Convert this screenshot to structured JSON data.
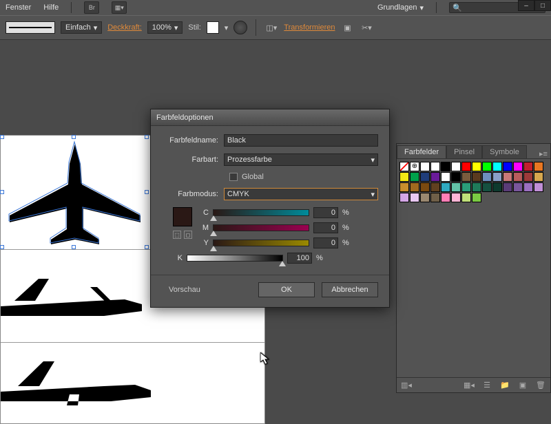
{
  "menubar": {
    "window": "Fenster",
    "help": "Hilfe",
    "br": "Br",
    "workspace": "Grundlagen"
  },
  "optbar": {
    "stroke_style": "Einfach",
    "opacity_label": "Deckkraft:",
    "opacity_value": "100%",
    "style_label": "Stil:",
    "transform": "Transformieren"
  },
  "dialog": {
    "title": "Farbfeldoptionen",
    "name_label": "Farbfeldname:",
    "name_value": "Black",
    "type_label": "Farbart:",
    "type_value": "Prozessfarbe",
    "global_label": "Global",
    "mode_label": "Farbmodus:",
    "mode_value": "CMYK",
    "channels": {
      "c": {
        "label": "C",
        "value": "0"
      },
      "m": {
        "label": "M",
        "value": "0"
      },
      "y": {
        "label": "Y",
        "value": "0"
      },
      "k": {
        "label": "K",
        "value": "100"
      }
    },
    "percent": "%",
    "preview_label": "Vorschau",
    "ok": "OK",
    "cancel": "Abbrechen"
  },
  "panel": {
    "tabs": {
      "swatches": "Farbfelder",
      "brushes": "Pinsel",
      "symbols": "Symbole"
    },
    "swatches": [
      "#ffffff",
      "#ffffff",
      "#000000",
      "#ffffff",
      "#ff0000",
      "#ffff00",
      "#00ff00",
      "#00ffff",
      "#0000ff",
      "#ff00ff",
      "#c01f2e",
      "#e87722",
      "#f6eb16",
      "#00a14b",
      "#1f3d7a",
      "#6a1b9a",
      "#ffffff",
      "#000000",
      "#7a5c3e",
      "#5a3a1f",
      "#6d8fbf",
      "#8aa0c8",
      "#c87878",
      "#b85c5c",
      "#9c3a3a",
      "#d6a84f",
      "#c98f2e",
      "#a06a1f",
      "#7a4a10",
      "#604020",
      "#2faac0",
      "#63c3a8",
      "#2a9d7a",
      "#1f7a5a",
      "#155040",
      "#0e3a2e",
      "#5a3c78",
      "#7a569c",
      "#9b6fbf",
      "#c08fd6",
      "#d6a8e8",
      "#e8c8f2",
      "#9a8870",
      "#6f5f48",
      "#ff7eb6",
      "#ffb6d6",
      "#bfe07a",
      "#7ac943"
    ]
  }
}
